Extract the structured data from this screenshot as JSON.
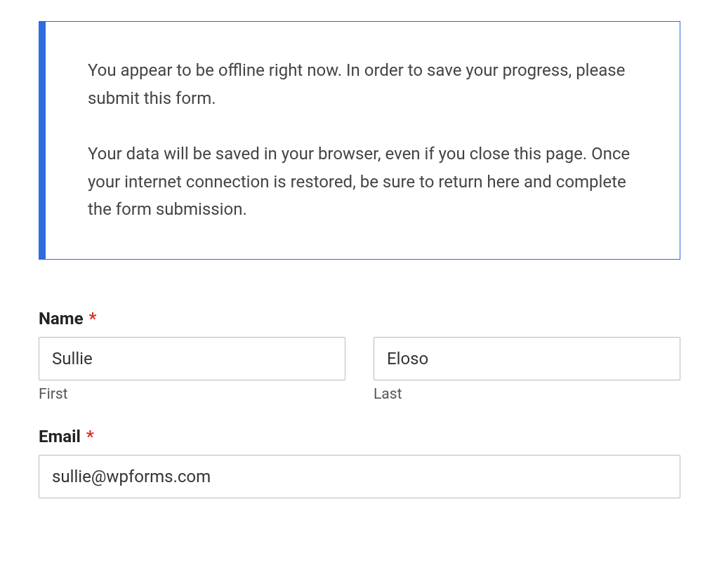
{
  "alert": {
    "paragraph1": "You appear to be offline right now. In order to save your progress, please submit this form.",
    "paragraph2": "Your data will be saved in your browser, even if you close this page. Once your internet connection is restored, be sure to return here and complete the form submission."
  },
  "form": {
    "name": {
      "label": "Name",
      "required_marker": "*",
      "first": {
        "value": "Sullie",
        "sublabel": "First"
      },
      "last": {
        "value": "Eloso",
        "sublabel": "Last"
      }
    },
    "email": {
      "label": "Email",
      "required_marker": "*",
      "value": "sullie@wpforms.com"
    }
  }
}
